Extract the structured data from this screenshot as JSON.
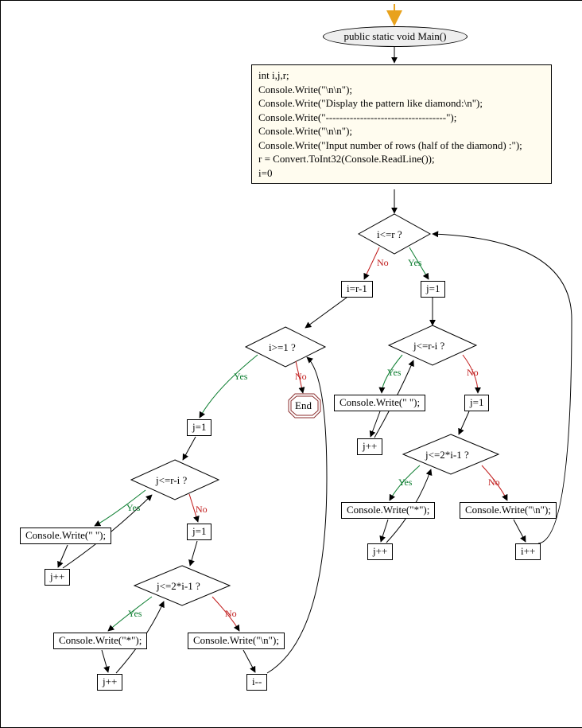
{
  "flowchart": {
    "start": "public static void Main()",
    "code_block": "int i,j,r;\nConsole.Write(\"\\n\\n\");\nConsole.Write(\"Display the pattern like diamond:\\n\");\nConsole.Write(\"-----------------------------------\");\nConsole.Write(\"\\n\\n\");\nConsole.Write(\"Input number of rows (half of the diamond) :\");\nr = Convert.ToInt32(Console.ReadLine());\ni=0",
    "end": "End",
    "dec_i_le_r": "i<=r ?",
    "box_i_eq_rm1": "i=r-1",
    "box_j1_r1": "j=1",
    "dec_i_ge_1": "i>=1 ?",
    "dec_j_le_rmi_r": "j<=r-i ?",
    "box_j1_l1": "j=1",
    "box_cw_space_r": "Console.Write(\" \");",
    "box_j1_r2": "j=1",
    "box_jpp_r1": "j++",
    "dec_j_le_2im1_r": "j<=2*i-1 ?",
    "dec_j_le_rmi_l": "j<=r-i ?",
    "box_cw_star_r": "Console.Write(\"*\");",
    "box_cw_nl_r": "Console.Write(\"\\n\");",
    "box_cw_space_l": "Console.Write(\" \");",
    "box_j1_l2": "j=1",
    "box_jpp_r2": "j++",
    "box_ipp": "i++",
    "box_jpp_l1": "j++",
    "dec_j_le_2im1_l": "j<=2*i-1 ?",
    "box_cw_star_l": "Console.Write(\"*\");",
    "box_cw_nl_l": "Console.Write(\"\\n\");",
    "box_jpp_l2": "j++",
    "box_idd": "i--",
    "labels": {
      "yes": "Yes",
      "no": "No"
    }
  }
}
